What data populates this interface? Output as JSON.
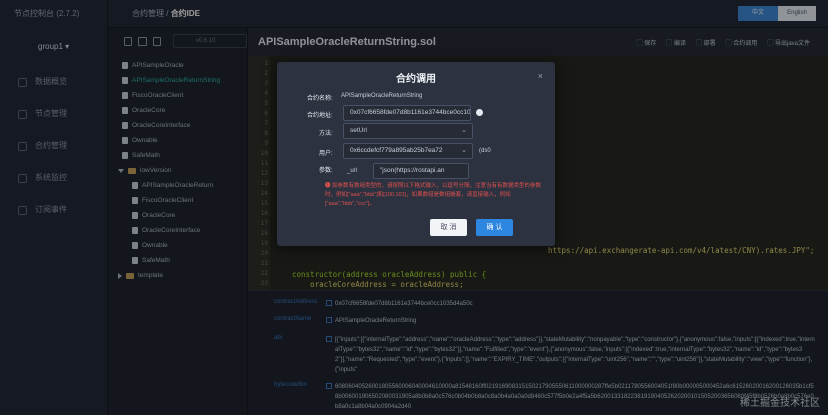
{
  "leftnav": {
    "brand": "节点控制台 (2.7.2)",
    "group": "group1 ▾",
    "items": [
      {
        "label": "数据概览"
      },
      {
        "label": "节点管理"
      },
      {
        "label": "合约管理"
      },
      {
        "label": "系统监控"
      },
      {
        "label": "订阅事件"
      }
    ]
  },
  "topbar": {
    "crumb_parent": "合约管理 /",
    "crumb_current": "合约IDE",
    "lang_zh": "中文",
    "lang_en": "English"
  },
  "filetree": {
    "version": "v0.6.10",
    "items": [
      {
        "label": "APISampleOracle",
        "kind": "file"
      },
      {
        "label": "APISampleOracleReturnString",
        "kind": "file",
        "active": true
      },
      {
        "label": "FiscoOracleClient",
        "kind": "file"
      },
      {
        "label": "OracleCore",
        "kind": "file"
      },
      {
        "label": "OracleCoreInterface",
        "kind": "file"
      },
      {
        "label": "Ownable",
        "kind": "file"
      },
      {
        "label": "SafeMath",
        "kind": "file"
      },
      {
        "label": "lowVersion",
        "kind": "folder-open"
      },
      {
        "label": "APISampleOracleReturn",
        "kind": "file"
      },
      {
        "label": "FiscoOracleClient",
        "kind": "file"
      },
      {
        "label": "OracleCore",
        "kind": "file"
      },
      {
        "label": "OracleCoreInterface",
        "kind": "file"
      },
      {
        "label": "Ownable",
        "kind": "file"
      },
      {
        "label": "SafeMath",
        "kind": "file"
      },
      {
        "label": "template",
        "kind": "folder-closed"
      }
    ]
  },
  "editor": {
    "filename": "APISampleOracleReturnString.sol",
    "actions": [
      "保存",
      "编译",
      "部署",
      "合约调用",
      "导出java文件"
    ],
    "line_numbers": [
      "1",
      "2",
      "3",
      "4",
      "5",
      "6",
      "7",
      "8",
      "9",
      "10",
      "11",
      "12",
      "13",
      "14",
      "15",
      "16",
      "17",
      "18",
      "19",
      "20",
      "21",
      "22",
      "23",
      "24"
    ],
    "code_visible": [
      {
        "text": "https://api.exchangerate-api.com/v4/latest/CNY).rates.JPY\";",
        "color": "#e6db74"
      },
      {
        "text": "constructor(address oracleAddress) public {",
        "color": "#a6e22e"
      },
      {
        "text": "    oracleCoreAddress = oracleAddress;",
        "color": "#e6db74"
      },
      {
        "text": "}",
        "color": "#f8f8f2"
      }
    ]
  },
  "modal": {
    "title": "合约调用",
    "close": "×",
    "name_label": "合约名称:",
    "name_value": "APISampleOracleReturnString",
    "address_label": "合约地址:",
    "address_value": "0x07cf6658fde07d8b1161e3744bce0cc1035d4a50c",
    "method_label": "方法:",
    "method_value": "setUrl",
    "user_label": "用户:",
    "user_value": "0x6ccdefcf779a895ab25b7ea72",
    "user_suffix": "(ds0",
    "param_label": "参数:",
    "param_type": "_url",
    "param_value": "\"json(https://rostapi.an",
    "warning": "❶ 如参数有数组类型的，请按照以下格式输入，以逗号分隔，注意当有有数据类型的参数时，例如[\"aaa\",\"bbb\"]和[100,101]，如果数组是数组嵌套，请直接输入，例如[\"aaa\",\"bbb\",\"ccc\"]。",
    "cancel": "取 消",
    "confirm": "确 认"
  },
  "result": {
    "rows": [
      {
        "key": "contractAddress",
        "value": "0x07cf6658fde07d8b1161e3744bce0cc1035d4a50c"
      },
      {
        "key": "contractName",
        "value": "APISampleOracleReturnString"
      },
      {
        "key": "abi",
        "value": "[{\"inputs\":[{\"internalType\":\"address\",\"name\":\"oracleAddress\",\"type\":\"address\"}],\"stateMutability\":\"nonpayable\",\"type\":\"constructor\"},{\"anonymous\":false,\"inputs\":[{\"indexed\":true,\"internalType\":\"bytes32\",\"name\":\"id\",\"type\":\"bytes32\"}],\"name\":\"Fulfilled\",\"type\":\"event\"},{\"anonymous\":false,\"inputs\":[{\"indexed\":true,\"internalType\":\"bytes32\",\"name\":\"id\",\"type\":\"bytes32\"}],\"name\":\"Requested\",\"type\":\"event\"},{\"inputs\":[],\"name\":\"EXPIRY_TIME\",\"outputs\":[{\"internalType\":\"uint256\",\"name\":\"\",\"type\":\"uint256\"}],\"stateMutability\":\"view\",\"type\":\"function\"},{\"inputs\""
      },
      {
        "key": "bytecodeBin",
        "value": "60806040526001805560006040004610000a81548160ff021916908315150217905550611000000287ffe5b0211780556004051f80b000005000452a6c61526020016200126035b1cf58b006001906502080031905a8b0b8a0c576c0b04b0b8a0c8a0b4a0a0a0d8460c577f5b0e2a4f5a5b62001331822381919040526202001015052003656080f45f8b0526b0a8b0c576e0b8a0c1a8b04a0c0904a2d40"
      }
    ]
  },
  "watermark": "稀土掘金技术社区",
  "colors": {
    "accent": "#3a86d6",
    "active_file": "#2fb5a8",
    "warning": "#e0514e",
    "confirm": "#2d86e0"
  }
}
